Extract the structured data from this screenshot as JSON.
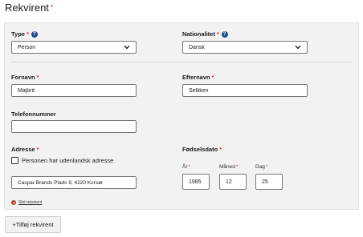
{
  "page": {
    "title": "Rekvirent",
    "required_mark": "*"
  },
  "type": {
    "label": "Type",
    "required": "*",
    "value": "Person"
  },
  "nationality": {
    "label": "Nationalitet",
    "required": "*",
    "value": "Dansk"
  },
  "first_name": {
    "label": "Fornavn",
    "required": "*",
    "value": "Majbrit"
  },
  "last_name": {
    "label": "Efternavn",
    "required": "*",
    "value": "Selliken"
  },
  "phone": {
    "label": "Telefonnummer",
    "value": ""
  },
  "address": {
    "label": "Adresse",
    "required": "*",
    "foreign_checkbox_label": "Personen har udenlandsk adresse",
    "foreign_checked": false,
    "value": "Caspar Brands Plads 9, 4220 Korsør"
  },
  "birthdate": {
    "label": "Fødselsdato",
    "required": "*",
    "year_label": "År",
    "month_label": "Måned",
    "day_label": "Dag",
    "year": "1985",
    "month": "12",
    "day": "25"
  },
  "remove_link": "Slet rekvirent",
  "add_button": "+Tilføj rekvirent",
  "icons": {
    "help": "question-circle-icon",
    "select": "chevron-down-icon",
    "remove": "minus-circle-icon"
  },
  "colors": {
    "required": "#c0392b",
    "help": "#1f4e8c",
    "panel": "#f2f2f2"
  }
}
